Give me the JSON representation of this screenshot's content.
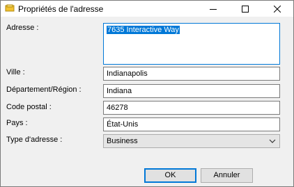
{
  "window": {
    "title": "Propriétés de l'adresse",
    "icon": "address-book-icon"
  },
  "form": {
    "address_label": "Adresse :",
    "address_value": "7635 Interactive Way",
    "city_label": "Ville :",
    "city_value": "Indianapolis",
    "region_label": "Département/Région :",
    "region_value": "Indiana",
    "postal_label": "Code postal :",
    "postal_value": "46278",
    "country_label": "Pays :",
    "country_value": "État-Unis",
    "type_label": "Type d'adresse :",
    "type_value": "Business"
  },
  "buttons": {
    "ok_label": "OK",
    "cancel_label": "Annuler"
  },
  "colors": {
    "accent": "#0078d7",
    "window_bg": "#f0f0f0"
  }
}
